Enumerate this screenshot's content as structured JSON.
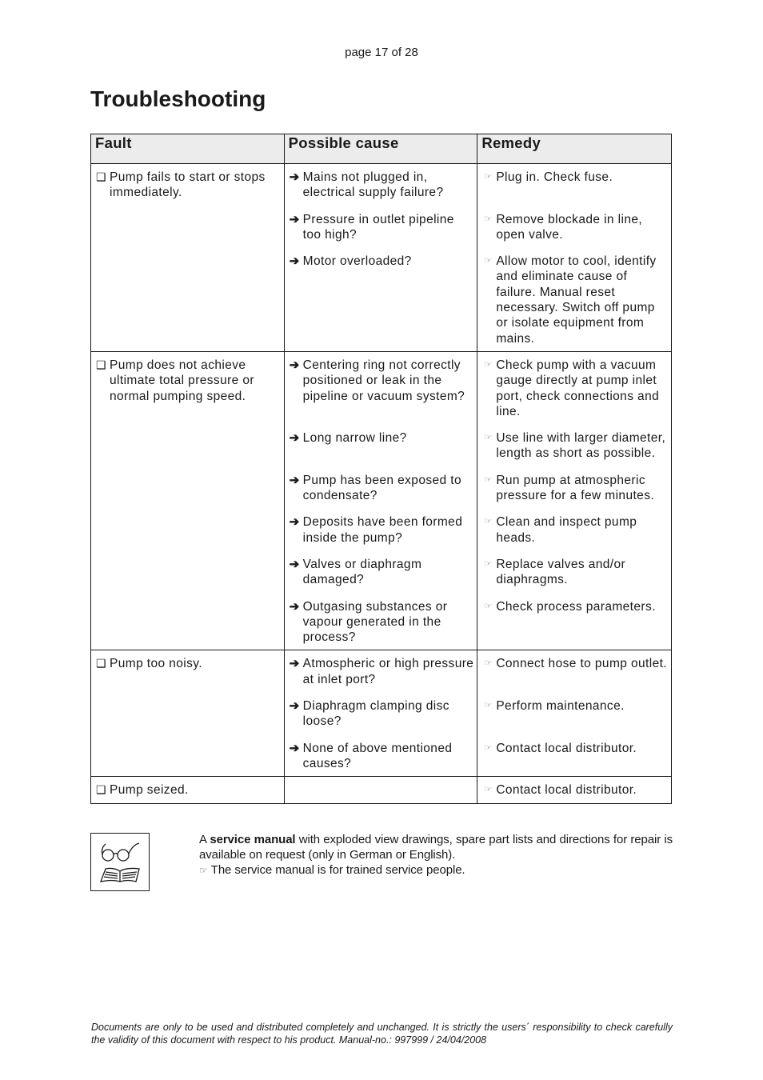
{
  "page_number": "page 17 of 28",
  "title": "Troubleshooting",
  "table": {
    "headers": [
      "Fault",
      "Possible cause",
      "Remedy"
    ],
    "groups": [
      {
        "fault": "Pump fails to start or stops immediately.",
        "rows": [
          {
            "cause": "Mains not plugged in, electrical supply failure?",
            "remedy": "Plug in. Check fuse."
          },
          {
            "cause": "Pressure in outlet pipeline too high?",
            "remedy": "Remove blockade in line, open valve."
          },
          {
            "cause": "Motor overloaded?",
            "remedy": "Allow  motor to cool, identify and eliminate cause of failure. Manual reset necessary. Switch off pump or isolate equipment from mains."
          }
        ]
      },
      {
        "fault": "Pump does not achieve ultimate total pressure or normal pumping speed.",
        "rows": [
          {
            "cause": "Centering ring not correctly positioned or leak in the pipeline or vacuum system?",
            "remedy": "Check pump with a vacuum gauge directly at pump inlet port, check connections and line."
          },
          {
            "cause": "Long narrow line?",
            "remedy": "Use line with larger diameter, length as short as possible."
          },
          {
            "cause": "Pump has been exposed to condensate?",
            "remedy": "Run pump at atmospheric pressure for a few minutes."
          },
          {
            "cause": "Deposits have been formed inside the pump?",
            "remedy": "Clean and inspect pump heads."
          },
          {
            "cause": "Valves or diaphragm damaged?",
            "remedy": "Replace valves and/or diaphragms."
          },
          {
            "cause": "Outgasing substances or vapour generated in the process?",
            "remedy": "Check process parameters."
          }
        ]
      },
      {
        "fault": "Pump too noisy.",
        "rows": [
          {
            "cause": "Atmospheric or high pressure at inlet port?",
            "remedy": "Connect hose to pump outlet."
          },
          {
            "cause": "Diaphragm clamping disc loose?",
            "remedy": "Perform maintenance."
          },
          {
            "cause": "None of above mentioned causes?",
            "remedy": "Contact local distributor."
          }
        ]
      },
      {
        "fault": "Pump seized.",
        "rows": [
          {
            "cause": "",
            "remedy": "Contact local distributor."
          }
        ]
      }
    ],
    "icons": {
      "fault": "checkbox-icon",
      "cause": "arrow-right-icon",
      "remedy": "pointing-hand-icon"
    }
  },
  "note": {
    "prefix": "A ",
    "bold": "service manual",
    "text": " with exploded view drawings, spare part lists and directions for repair is available on request (only in German or English).",
    "hint": "The service manual is for trained service people."
  },
  "footer": "Documents are only to be used and distributed completely and unchanged. It is strictly the users´ responsibility to check carefully the validity of this document with respect to his product. Manual-no.: 997999 / 24/04/2008"
}
